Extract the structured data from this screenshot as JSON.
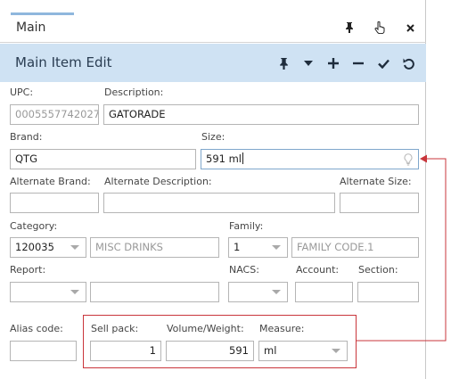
{
  "window": {
    "tab_title": "Main",
    "title_icons": [
      "pin-icon",
      "pointer-hand-icon",
      "close-icon"
    ]
  },
  "header": {
    "title": "Main Item Edit",
    "toolbar": [
      "pin-icon",
      "chevron-down-icon",
      "add-icon",
      "minus-icon",
      "check-icon",
      "undo-icon"
    ]
  },
  "form": {
    "upc": {
      "label": "UPC:",
      "value": "0005557742027"
    },
    "description": {
      "label": "Description:",
      "value": "GATORADE"
    },
    "brand": {
      "label": "Brand:",
      "value": "QTG"
    },
    "size": {
      "label": "Size:",
      "value": "591 ml"
    },
    "alternate_brand": {
      "label": "Alternate Brand:",
      "value": ""
    },
    "alternate_description": {
      "label": "Alternate Description:",
      "value": ""
    },
    "alternate_size": {
      "label": "Alternate Size:",
      "value": ""
    },
    "category": {
      "label": "Category:",
      "code": "120035",
      "name": "MISC DRINKS"
    },
    "family": {
      "label": "Family:",
      "code": "1",
      "name": "FAMILY CODE.1"
    },
    "report": {
      "label": "Report:",
      "code": "",
      "name": ""
    },
    "nacs": {
      "label": "NACS:",
      "value": ""
    },
    "account": {
      "label": "Account:",
      "value": ""
    },
    "section": {
      "label": "Section:",
      "value": ""
    },
    "alias_code": {
      "label": "Alias code:",
      "value": ""
    },
    "sell_pack": {
      "label": "Sell pack:",
      "value": "1"
    },
    "volume_weight": {
      "label": "Volume/Weight:",
      "value": "591"
    },
    "measure": {
      "label": "Measure:",
      "value": "ml"
    }
  },
  "colors": {
    "header_bg": "#cfe2f3",
    "annotation_red": "#c9353b",
    "tab_accent": "#8fb7dd"
  }
}
